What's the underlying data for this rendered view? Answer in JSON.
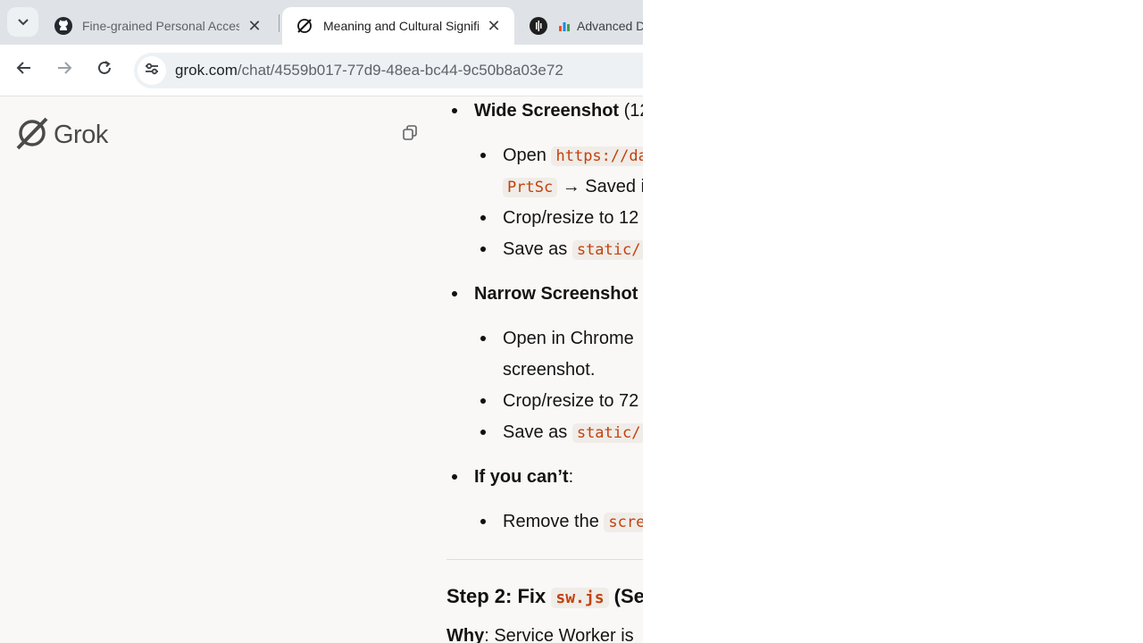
{
  "browser": {
    "tabs": [
      {
        "title": "Fine-grained Personal Access Tokens",
        "icon": "github-icon",
        "active": false
      },
      {
        "title": "Meaning and Cultural Significance",
        "icon": "grok-icon",
        "active": true
      },
      {
        "title": "Advanced D",
        "icon": "chart-icon",
        "active": false
      }
    ],
    "url_domain": "grok.com",
    "url_path": "/chat/4559b017-77d9-48ea-bc44-9c50b8a03e72"
  },
  "sidebar": {
    "logo_text": "Grok"
  },
  "content": {
    "wide": {
      "label": "Wide Screenshot",
      "suffix": " (12",
      "open_prefix": "Open ",
      "open_code": "https://da",
      "prtsc_code": "PrtSc",
      "saved_text": " → Saved i",
      "crop_text": "Crop/resize to 12",
      "save_prefix": "Save as ",
      "save_code": "static/"
    },
    "narrow": {
      "label": "Narrow Screenshot",
      "open_text": "Open in Chrome",
      "open_text_2": "screenshot.",
      "crop_text": "Crop/resize to 72",
      "save_prefix": "Save as ",
      "save_code": "static/"
    },
    "cant": {
      "label": "If you can’t",
      "colon": ":",
      "remove_prefix": "Remove the ",
      "remove_code": "scre"
    },
    "step2": {
      "prefix": "Step 2: Fix ",
      "code": "sw.js",
      "suffix": " (Ser"
    },
    "why": {
      "label": "Why",
      "text": ": Service Worker is"
    }
  },
  "colors": {
    "code_text": "#c2410c",
    "code_bg": "#f0ece8",
    "page_bg": "#f9f8f6",
    "tabstrip_bg": "#dfe3e7"
  }
}
